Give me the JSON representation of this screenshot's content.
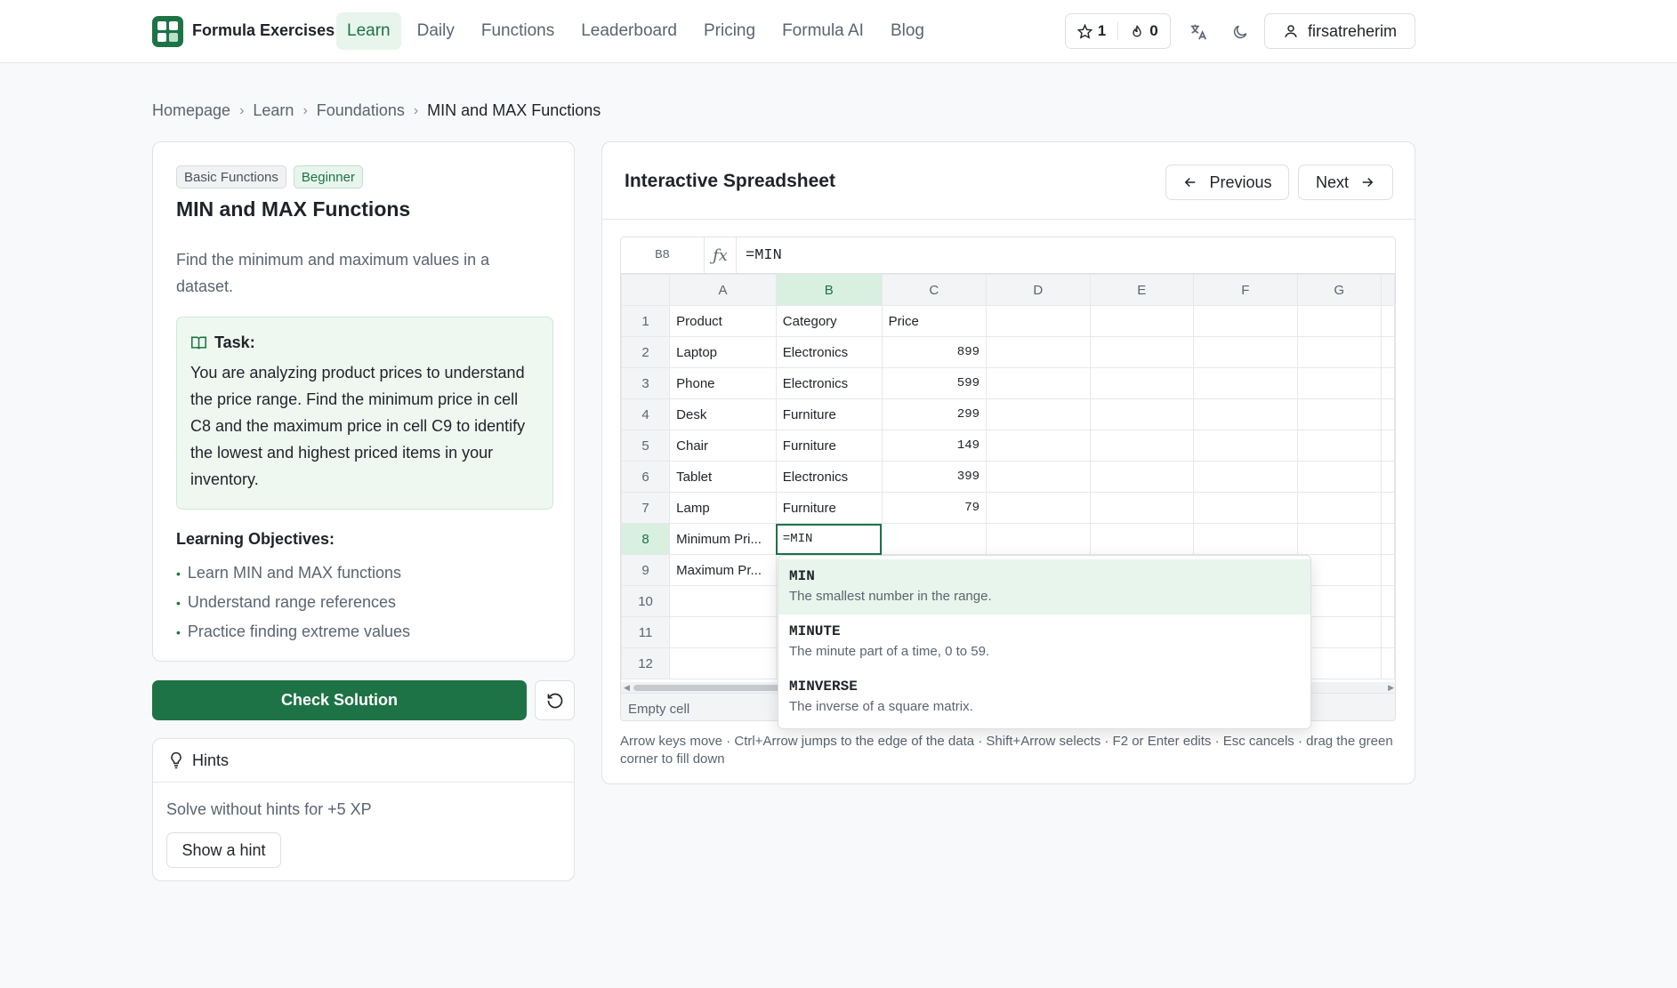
{
  "header": {
    "brand": "Formula Exercises",
    "nav": [
      {
        "label": "Learn",
        "active": true
      },
      {
        "label": "Daily",
        "active": false
      },
      {
        "label": "Functions",
        "active": false
      },
      {
        "label": "Leaderboard",
        "active": false
      },
      {
        "label": "Pricing",
        "active": false
      },
      {
        "label": "Formula AI",
        "active": false
      },
      {
        "label": "Blog",
        "active": false
      }
    ],
    "stars": "1",
    "streak": "0",
    "username": "firsatreherim"
  },
  "breadcrumb": [
    "Homepage",
    "Learn",
    "Foundations",
    "MIN and MAX Functions"
  ],
  "lesson": {
    "badge_category": "Basic Functions",
    "badge_level": "Beginner",
    "title": "MIN and MAX Functions",
    "description": "Find the minimum and maximum values in a dataset.",
    "task_label": "Task:",
    "task_text": "You are analyzing product prices to understand the price range. Find the minimum price in cell C8 and the maximum price in cell C9 to identify the lowest and highest priced items in your inventory.",
    "objectives_title": "Learning Objectives:",
    "objectives": [
      "Learn MIN and MAX functions",
      "Understand range references",
      "Practice finding extreme values"
    ]
  },
  "actions": {
    "check": "Check Solution"
  },
  "hints": {
    "title": "Hints",
    "text": "Solve without hints for +5 XP",
    "button": "Show a hint"
  },
  "sheet": {
    "title": "Interactive Spreadsheet",
    "prev": "Previous",
    "next": "Next",
    "cell_ref": "B8",
    "fx": "ƒx",
    "formula": "=MIN",
    "columns": [
      "A",
      "B",
      "C",
      "D",
      "E",
      "F",
      "G"
    ],
    "rows": [
      [
        "Product",
        "Category",
        "Price"
      ],
      [
        "Laptop",
        "Electronics",
        "899"
      ],
      [
        "Phone",
        "Electronics",
        "599"
      ],
      [
        "Desk",
        "Furniture",
        "299"
      ],
      [
        "Chair",
        "Furniture",
        "149"
      ],
      [
        "Tablet",
        "Electronics",
        "399"
      ],
      [
        "Lamp",
        "Furniture",
        "79"
      ],
      [
        "Minimum Pri...",
        "=MIN",
        ""
      ],
      [
        "Maximum Pr...",
        "",
        ""
      ],
      [
        "",
        "",
        ""
      ],
      [
        "",
        "",
        ""
      ],
      [
        "",
        "",
        ""
      ]
    ],
    "status": "Empty cell",
    "autocomplete": [
      {
        "name": "MIN",
        "desc": "The smallest number in the range."
      },
      {
        "name": "MINUTE",
        "desc": "The minute part of a time, 0 to 59."
      },
      {
        "name": "MINVERSE",
        "desc": "The inverse of a square matrix."
      }
    ],
    "help": "Arrow keys move · Ctrl+Arrow jumps to the edge of the data · Shift+Arrow selects · F2 or Enter edits · Esc cancels · drag the green corner to fill down"
  }
}
